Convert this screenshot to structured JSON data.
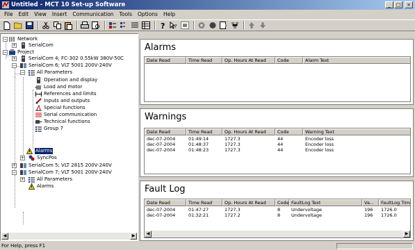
{
  "window": {
    "title": "Untitled - MCT 10 Set-up Software"
  },
  "menu": [
    "File",
    "Edit",
    "View",
    "Insert",
    "Communication",
    "Tools",
    "Options",
    "Help"
  ],
  "tree": {
    "network": "Network",
    "serialcom": "SerialCom",
    "project": "Project",
    "sc4": "SerialCom 4; FC-302 0.55kW 380V-50C",
    "sc6": "SerialCom 6; VLT 5001 200V-240V",
    "allparams": "All Parameters",
    "op_display": "Operation and display",
    "load_motor": "Load and motor",
    "refs_limits": "References and limits",
    "inputs_outputs": "Inputs and outputs",
    "special": "Special functions",
    "serialcomm": "Serial communication",
    "technical": "Technical functions",
    "group7": "Group 7",
    "alarms_selected": "Alarms",
    "syncpos": "SyncPos",
    "sc5": "SerialCom 5; VLT 2815 200V-240V",
    "sc7": "SerialCom 7; VLT 5001 200V-240V",
    "allparams2": "All Parameters",
    "alarms2": "Alarms"
  },
  "alarms": {
    "title": "Alarms",
    "columns": [
      "Date Read",
      "Time Read",
      "Op. Hours At Read",
      "Code",
      "Alarm Text"
    ],
    "rows": []
  },
  "warnings": {
    "title": "Warnings",
    "columns": [
      "Date Read",
      "Time Read",
      "Op. Hours At Read",
      "Code",
      "Warning Text"
    ],
    "rows": [
      [
        "dec-07-2004",
        "01:49:14",
        "1727.3",
        "44",
        "Encoder loss"
      ],
      [
        "dec-07-2004",
        "01:48:37",
        "1727.3",
        "44",
        "Encoder loss"
      ],
      [
        "dec-07-2004",
        "01:48:23",
        "1727.3",
        "44",
        "Encoder loss"
      ]
    ]
  },
  "faultlog": {
    "title": "Fault Log",
    "columns": [
      "Date Read",
      "Time Read",
      "Op. Hours At Read",
      "Code",
      "FaultLog Text",
      "Va...",
      "FaultLog Time"
    ],
    "rows": [
      [
        "dec-07-2004",
        "01:47:27",
        "1727.3",
        "8",
        "Undervoltage",
        "196",
        "1726.0"
      ],
      [
        "dec-07-2004",
        "01:32:21",
        "1727.2",
        "8",
        "Undervoltage",
        "196",
        "1726.0"
      ]
    ]
  },
  "status": {
    "text": "For Help, press F1"
  }
}
